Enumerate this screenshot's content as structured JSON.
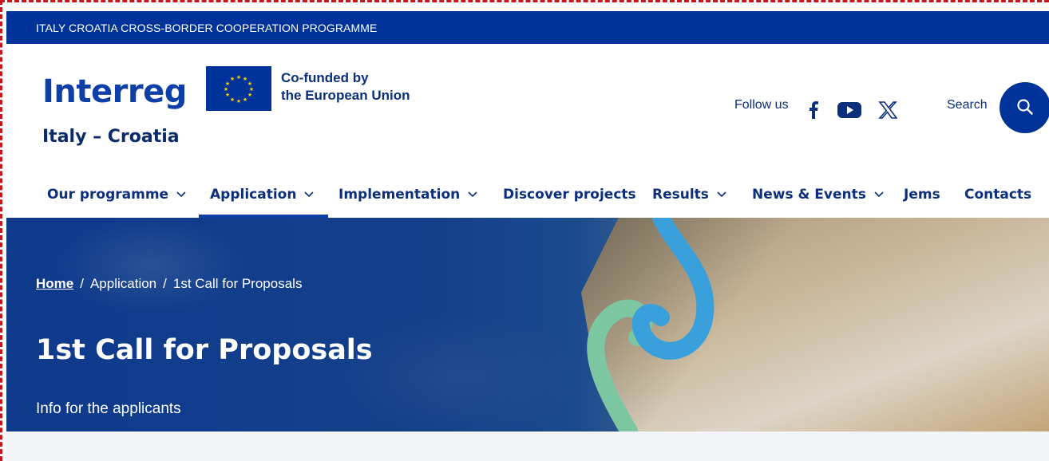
{
  "topbar": {
    "text": "ITALY CROATIA CROSS-BORDER COOPERATION PROGRAMME"
  },
  "logo": {
    "wordmark": "Interreg",
    "subtitle": "Italy – Croatia"
  },
  "eu": {
    "line1": "Co-funded by",
    "line2": "the European Union"
  },
  "social": {
    "follow_label": "Follow us",
    "icons": [
      "facebook-icon",
      "youtube-icon",
      "x-icon"
    ]
  },
  "search": {
    "label": "Search",
    "icon": "search-icon"
  },
  "nav": {
    "items": [
      {
        "label": "Our programme",
        "has_dropdown": true
      },
      {
        "label": "Application",
        "has_dropdown": true,
        "active": true
      },
      {
        "label": "Implementation",
        "has_dropdown": true
      },
      {
        "label": "Discover projects",
        "has_dropdown": false
      },
      {
        "label": "Results",
        "has_dropdown": true
      },
      {
        "label": "News & Events",
        "has_dropdown": true
      },
      {
        "label": "Jems",
        "has_dropdown": false
      },
      {
        "label": "Contacts",
        "has_dropdown": false
      }
    ]
  },
  "breadcrumb": {
    "home": "Home",
    "sep1": "/",
    "level2": "Application",
    "sep2": "/",
    "current": "1st Call for Proposals"
  },
  "hero": {
    "title": "1st Call for Proposals",
    "subtitle": "Info for the applicants"
  },
  "colors": {
    "brand_blue": "#003399",
    "text_navy": "#0b2f7a",
    "accent_light_blue": "#3aa0dc",
    "accent_green": "#7cc6a2"
  }
}
